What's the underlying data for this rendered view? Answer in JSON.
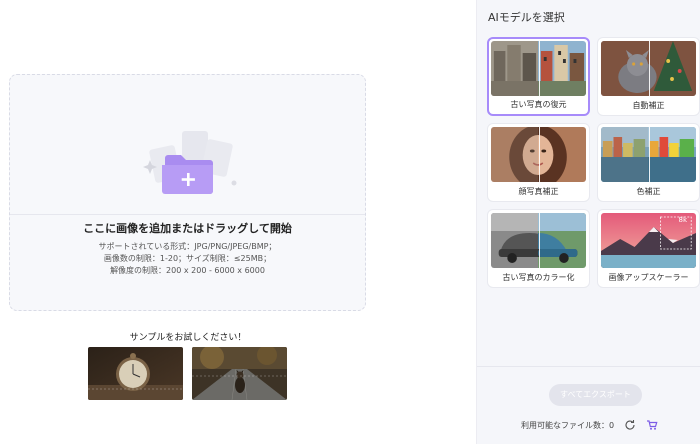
{
  "upload": {
    "title": "ここに画像を追加またはドラッグして開始",
    "formats": "サポートされている形式：JPG/PNG/JPEG/BMP；",
    "limits": "画像数の制限：1-20；サイズ制限：≤25MB；",
    "resolution": "解像度の制限：200 x 200 - 6000 x 6000"
  },
  "samples": {
    "label": "サンプルをお試しください！",
    "items": [
      "pocket-watch",
      "dog-on-road"
    ]
  },
  "sidebar": {
    "title": "AIモデルを選択",
    "models": [
      {
        "label": "古い写真の復元",
        "selected": true
      },
      {
        "label": "自動補正",
        "selected": false
      },
      {
        "label": "顔写真補正",
        "selected": false
      },
      {
        "label": "色補正",
        "selected": false
      },
      {
        "label": "古い写真のカラー化",
        "selected": false
      },
      {
        "label": "画像アップスケーラー",
        "selected": false
      }
    ],
    "export_label": "すべてエクスポート",
    "files_label": "利用可能なファイル数：0",
    "upscale_badge": "8k"
  },
  "colors": {
    "accent": "#a78bfa",
    "folder": "#a98cf0",
    "cart": "#7c5ce6"
  }
}
